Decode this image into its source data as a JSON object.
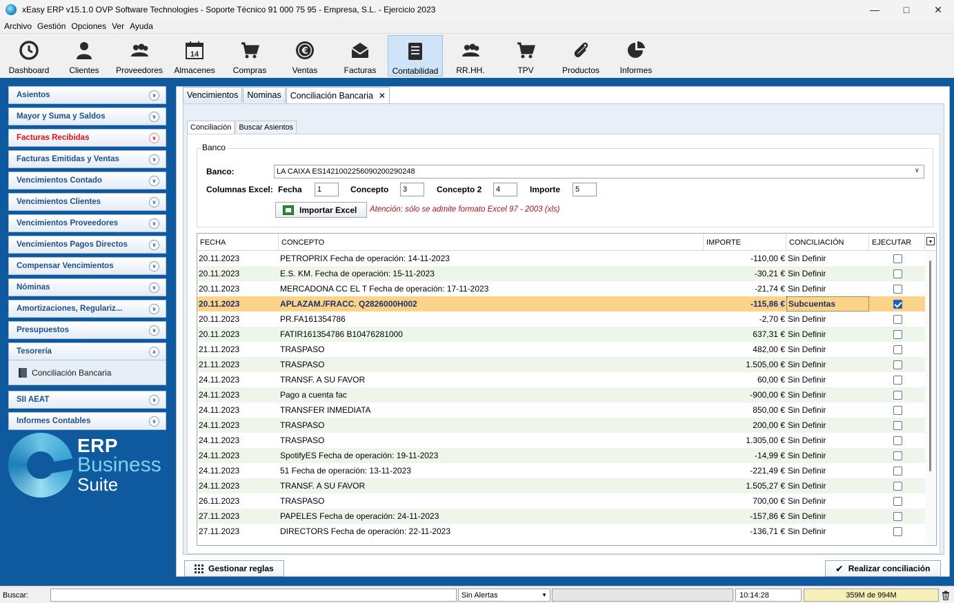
{
  "window": {
    "title": "xEasy ERP v15.1.0 OVP Software Technologies - Soporte Técnico 91 000 75 95 - Empresa, S.L. - Ejercicio 2023"
  },
  "menu": [
    "Archivo",
    "Gestión",
    "Opciones",
    "Ver",
    "Ayuda"
  ],
  "toolbar": [
    {
      "label": "Dashboard",
      "icon": "clock-icon"
    },
    {
      "label": "Clientes",
      "icon": "person-icon"
    },
    {
      "label": "Proveedores",
      "icon": "people-icon"
    },
    {
      "label": "Almacenes",
      "icon": "calendar-icon"
    },
    {
      "label": "Compras",
      "icon": "cart-icon"
    },
    {
      "label": "Ventas",
      "icon": "euro-icon"
    },
    {
      "label": "Facturas",
      "icon": "envelope-icon"
    },
    {
      "label": "Contabilidad",
      "icon": "ledger-icon"
    },
    {
      "label": "RR.HH.",
      "icon": "people-icon"
    },
    {
      "label": "TPV",
      "icon": "cart-icon"
    },
    {
      "label": "Productos",
      "icon": "paperclip-icon"
    },
    {
      "label": "Informes",
      "icon": "pie-chart-icon"
    }
  ],
  "sidebar": {
    "items": [
      {
        "label": "Asientos"
      },
      {
        "label": "Mayor y Suma y Saldos"
      },
      {
        "label": "Facturas Recibidas",
        "highlight": "#dd1111"
      },
      {
        "label": "Facturas Emitidas y Ventas"
      },
      {
        "label": "Vencimientos Contado"
      },
      {
        "label": "Vencimientos Clientes"
      },
      {
        "label": "Vencimientos Proveedores"
      },
      {
        "label": "Vencimientos Pagos Directos"
      },
      {
        "label": "Compensar Vencimientos"
      },
      {
        "label": "Nóminas"
      },
      {
        "label": "Amortizaciones, Regulariz..."
      },
      {
        "label": "Presupuestos"
      },
      {
        "label": "Tesorería",
        "expanded": true
      },
      {
        "label": "SII AEAT"
      },
      {
        "label": "Informes Contables"
      }
    ],
    "tesoreria_sub": "Conciliación Bancaria",
    "logo": {
      "line1": "ERP",
      "line2": "Business",
      "line3": "Suite"
    }
  },
  "tabs": [
    "Vencimientos",
    "Nominas",
    "Conciliación Bancaria"
  ],
  "subtabs": [
    "Conciliación",
    "Buscar Asientos"
  ],
  "banco": {
    "legend": "Banco",
    "banco_label": "Banco:",
    "banco_value": "LA CAIXA ES1421002256090200290248",
    "columnas_label": "Columnas Excel:",
    "fecha_label": "Fecha",
    "fecha_value": "1",
    "concepto_label": "Concepto",
    "concepto_value": "3",
    "concepto2_label": "Concepto 2",
    "concepto2_value": "4",
    "importe_label": "Importe",
    "importe_value": "5",
    "import_button": "Importar Excel",
    "warning": "Atención: sólo se admite formato Excel 97 - 2003 (xls)"
  },
  "grid": {
    "columns": [
      "FECHA",
      "CONCEPTO",
      "IMPORTE",
      "CONCILIACIÓN",
      "EJECUTAR"
    ],
    "rows": [
      {
        "fecha": "20.11.2023",
        "concepto": "PETROPRIX Fecha de operación: 14-11-2023",
        "importe": "-110,00 €",
        "conciliacion": "Sin Definir",
        "ejecutar": false
      },
      {
        "fecha": "20.11.2023",
        "concepto": "E.S. KM. Fecha de operación: 15-11-2023",
        "importe": "-30,21 €",
        "conciliacion": "Sin Definir",
        "ejecutar": false
      },
      {
        "fecha": "20.11.2023",
        "concepto": "MERCADONA CC EL T Fecha de operación: 17-11-2023",
        "importe": "-21,74 €",
        "conciliacion": "Sin Definir",
        "ejecutar": false
      },
      {
        "fecha": "20.11.2023",
        "concepto": "APLAZAM./FRACC. Q2826000H002",
        "importe": "-115,86 €",
        "conciliacion": "Subcuentas",
        "ejecutar": true,
        "selected": true
      },
      {
        "fecha": "20.11.2023",
        "concepto": "PR.FA161354786",
        "importe": "-2,70 €",
        "conciliacion": "Sin Definir",
        "ejecutar": false
      },
      {
        "fecha": "20.11.2023",
        "concepto": "FATIR161354786 B10476281000",
        "importe": "637,31 €",
        "conciliacion": "Sin Definir",
        "ejecutar": false
      },
      {
        "fecha": "21.11.2023",
        "concepto": "TRASPASO",
        "importe": "482,00 €",
        "conciliacion": "Sin Definir",
        "ejecutar": false
      },
      {
        "fecha": "21.11.2023",
        "concepto": "TRASPASO",
        "importe": "1.505,00 €",
        "conciliacion": "Sin Definir",
        "ejecutar": false
      },
      {
        "fecha": "24.11.2023",
        "concepto": "TRANSF. A SU FAVOR",
        "importe": "60,00 €",
        "conciliacion": "Sin Definir",
        "ejecutar": false
      },
      {
        "fecha": "24.11.2023",
        "concepto": "Pago a cuenta fac",
        "importe": "-900,00 €",
        "conciliacion": "Sin Definir",
        "ejecutar": false
      },
      {
        "fecha": "24.11.2023",
        "concepto": "TRANSFER INMEDIATA",
        "importe": "850,00 €",
        "conciliacion": "Sin Definir",
        "ejecutar": false
      },
      {
        "fecha": "24.11.2023",
        "concepto": "TRASPASO",
        "importe": "200,00 €",
        "conciliacion": "Sin Definir",
        "ejecutar": false
      },
      {
        "fecha": "24.11.2023",
        "concepto": "TRASPASO",
        "importe": "1.305,00 €",
        "conciliacion": "Sin Definir",
        "ejecutar": false
      },
      {
        "fecha": "24.11.2023",
        "concepto": "SpotifyES Fecha de operación: 19-11-2023",
        "importe": "-14,99 €",
        "conciliacion": "Sin Definir",
        "ejecutar": false
      },
      {
        "fecha": "24.11.2023",
        "concepto": "51 Fecha de operación: 13-11-2023",
        "importe": "-221,49 €",
        "conciliacion": "Sin Definir",
        "ejecutar": false
      },
      {
        "fecha": "24.11.2023",
        "concepto": "TRANSF. A SU FAVOR",
        "importe": "1.505,27 €",
        "conciliacion": "Sin Definir",
        "ejecutar": false
      },
      {
        "fecha": "26.11.2023",
        "concepto": "TRASPASO",
        "importe": "700,00 €",
        "conciliacion": "Sin Definir",
        "ejecutar": false
      },
      {
        "fecha": "27.11.2023",
        "concepto": "PAPELES Fecha de operación: 24-11-2023",
        "importe": "-157,86 €",
        "conciliacion": "Sin Definir",
        "ejecutar": false
      },
      {
        "fecha": "27.11.2023",
        "concepto": "DIRECTORS Fecha de operación: 22-11-2023",
        "importe": "-136,71 €",
        "conciliacion": "Sin Definir",
        "ejecutar": false
      }
    ]
  },
  "buttons": {
    "gestionar": "Gestionar reglas",
    "realizar": "Realizar conciliación"
  },
  "statusbar": {
    "buscar_label": "Buscar:",
    "alertas": "Sin Alertas",
    "time": "10:14:28",
    "memory": "359M de 994M"
  }
}
